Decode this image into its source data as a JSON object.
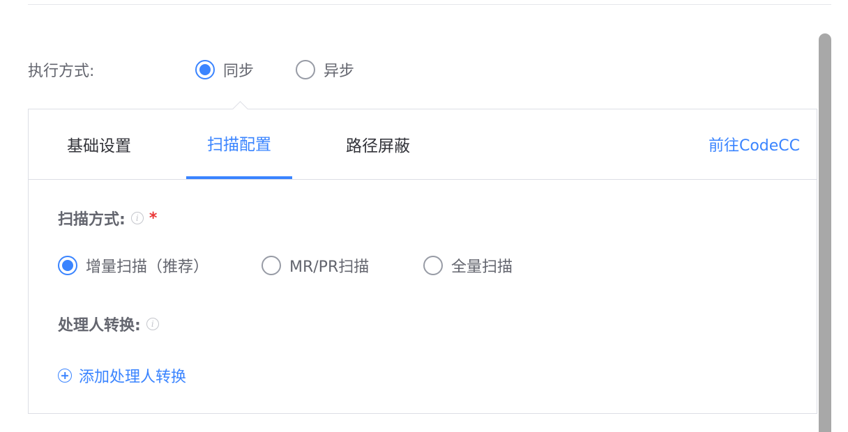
{
  "execution": {
    "label": "执行方式:",
    "options": [
      {
        "label": "同步",
        "checked": true
      },
      {
        "label": "异步",
        "checked": false
      }
    ]
  },
  "tabs": [
    {
      "label": "基础设置",
      "active": false
    },
    {
      "label": "扫描配置",
      "active": true
    },
    {
      "label": "路径屏蔽",
      "active": false
    }
  ],
  "codecc_link": "前往CodeCC",
  "scan_mode": {
    "label": "扫描方式:",
    "required_mark": "*",
    "options": [
      {
        "label": "增量扫描（推荐）",
        "checked": true
      },
      {
        "label": "MR/PR扫描",
        "checked": false
      },
      {
        "label": "全量扫描",
        "checked": false
      }
    ]
  },
  "handler_conversion": {
    "label": "处理人转换:",
    "add_label": "添加处理人转换"
  },
  "info_icon_glyph": "i",
  "colors": {
    "accent": "#3a84ff",
    "required": "#ea3636",
    "text": "#63656e",
    "border": "#dcdee5"
  }
}
